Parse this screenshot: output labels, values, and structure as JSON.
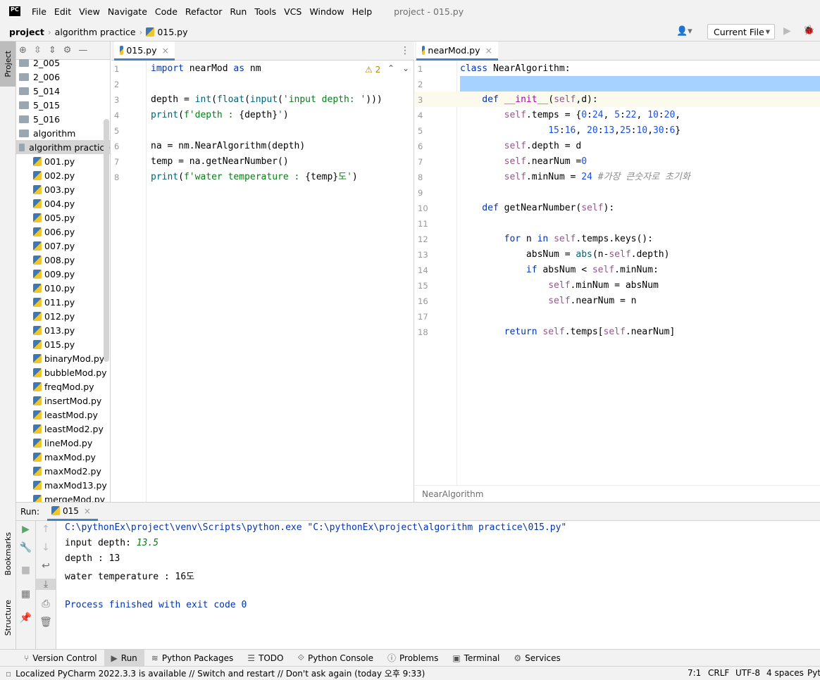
{
  "app": {
    "logo": "PC",
    "window_title": "project - 015.py",
    "menus": [
      "File",
      "Edit",
      "View",
      "Navigate",
      "Code",
      "Refactor",
      "Run",
      "Tools",
      "VCS",
      "Window",
      "Help"
    ]
  },
  "nav": {
    "project": "project",
    "folder": "algorithm practice",
    "file": "015.py",
    "run_config": "Current File"
  },
  "stripe": {
    "project": "Project",
    "bookmarks": "Bookmarks",
    "structure": "Structure"
  },
  "tree": {
    "items": [
      {
        "label": "2_005",
        "type": "folder",
        "indent": 0
      },
      {
        "label": "2_006",
        "type": "folder",
        "indent": 0
      },
      {
        "label": "5_014",
        "type": "folder",
        "indent": 0
      },
      {
        "label": "5_015",
        "type": "folder",
        "indent": 0
      },
      {
        "label": "5_016",
        "type": "folder",
        "indent": 0
      },
      {
        "label": "algorithm",
        "type": "folder",
        "indent": 0
      },
      {
        "label": "algorithm practice",
        "type": "folder",
        "indent": 0,
        "selected": true
      },
      {
        "label": "001.py",
        "type": "py",
        "indent": 1
      },
      {
        "label": "002.py",
        "type": "py",
        "indent": 1
      },
      {
        "label": "003.py",
        "type": "py",
        "indent": 1
      },
      {
        "label": "004.py",
        "type": "py",
        "indent": 1
      },
      {
        "label": "005.py",
        "type": "py",
        "indent": 1
      },
      {
        "label": "006.py",
        "type": "py",
        "indent": 1
      },
      {
        "label": "007.py",
        "type": "py",
        "indent": 1
      },
      {
        "label": "008.py",
        "type": "py",
        "indent": 1
      },
      {
        "label": "009.py",
        "type": "py",
        "indent": 1
      },
      {
        "label": "010.py",
        "type": "py",
        "indent": 1
      },
      {
        "label": "011.py",
        "type": "py",
        "indent": 1
      },
      {
        "label": "012.py",
        "type": "py",
        "indent": 1
      },
      {
        "label": "013.py",
        "type": "py",
        "indent": 1
      },
      {
        "label": "015.py",
        "type": "py",
        "indent": 1
      },
      {
        "label": "binaryMod.py",
        "type": "py",
        "indent": 1
      },
      {
        "label": "bubbleMod.py",
        "type": "py",
        "indent": 1
      },
      {
        "label": "freqMod.py",
        "type": "py",
        "indent": 1
      },
      {
        "label": "insertMod.py",
        "type": "py",
        "indent": 1
      },
      {
        "label": "leastMod.py",
        "type": "py",
        "indent": 1
      },
      {
        "label": "leastMod2.py",
        "type": "py",
        "indent": 1
      },
      {
        "label": "lineMod.py",
        "type": "py",
        "indent": 1
      },
      {
        "label": "maxMod.py",
        "type": "py",
        "indent": 1
      },
      {
        "label": "maxMod2.py",
        "type": "py",
        "indent": 1
      },
      {
        "label": "maxMod13.py",
        "type": "py",
        "indent": 1
      },
      {
        "label": "mergeMod.py",
        "type": "py",
        "indent": 1
      }
    ]
  },
  "editor1": {
    "tab": "015.py",
    "warnings": "2",
    "lines": [
      [
        [
          "import ",
          "kw"
        ],
        [
          "nearMod ",
          ""
        ],
        [
          "as ",
          "kw"
        ],
        [
          "nm",
          ""
        ]
      ],
      [],
      [
        [
          "depth = ",
          ""
        ],
        [
          "int",
          "fn"
        ],
        [
          "(",
          ""
        ],
        [
          "float",
          "fn"
        ],
        [
          "(",
          ""
        ],
        [
          "input",
          "fn"
        ],
        [
          "(",
          ""
        ],
        [
          "'input depth: '",
          "str"
        ],
        [
          ")))",
          ""
        ]
      ],
      [
        [
          "print",
          "fn"
        ],
        [
          "(",
          ""
        ],
        [
          "f'depth : ",
          "str"
        ],
        [
          "{depth}",
          ""
        ],
        [
          "'",
          "str"
        ],
        [
          ")",
          ""
        ]
      ],
      [],
      [
        [
          "na = nm.NearAlgorithm(depth)",
          ""
        ]
      ],
      [
        [
          "temp = na.getNearNumber()",
          ""
        ]
      ],
      [
        [
          "print",
          "fn"
        ],
        [
          "(",
          ""
        ],
        [
          "f'water temperature : ",
          "str"
        ],
        [
          "{temp}",
          ""
        ],
        [
          "도'",
          "str"
        ],
        [
          ")",
          ""
        ]
      ]
    ]
  },
  "editor2": {
    "tab": "nearMod.py",
    "breadcrumb": "NearAlgorithm",
    "lines": [
      [
        [
          "class ",
          "kw"
        ],
        [
          "NearAlgorithm:",
          ""
        ]
      ],
      [],
      [
        [
          "    def ",
          "kw"
        ],
        [
          "__init__",
          "mag"
        ],
        [
          "(",
          ""
        ],
        [
          "self",
          "self"
        ],
        [
          ",d):",
          ""
        ]
      ],
      [
        [
          "        self",
          "self"
        ],
        [
          ".temps = {",
          ""
        ],
        [
          "0",
          "num"
        ],
        [
          ":",
          ""
        ],
        [
          "24",
          "num"
        ],
        [
          ", ",
          ""
        ],
        [
          "5",
          "num"
        ],
        [
          ":",
          ""
        ],
        [
          "22",
          "num"
        ],
        [
          ", ",
          ""
        ],
        [
          "10",
          "num"
        ],
        [
          ":",
          ""
        ],
        [
          "20",
          "num"
        ],
        [
          ",",
          ""
        ]
      ],
      [
        [
          "                ",
          ""
        ],
        [
          "15",
          "num"
        ],
        [
          ":",
          ""
        ],
        [
          "16",
          "num"
        ],
        [
          ", ",
          ""
        ],
        [
          "20",
          "num"
        ],
        [
          ":",
          ""
        ],
        [
          "13",
          "num"
        ],
        [
          ",",
          ""
        ],
        [
          "25",
          "num"
        ],
        [
          ":",
          ""
        ],
        [
          "10",
          "num"
        ],
        [
          ",",
          ""
        ],
        [
          "30",
          "num"
        ],
        [
          ":",
          ""
        ],
        [
          "6",
          "num"
        ],
        [
          "}",
          ""
        ]
      ],
      [
        [
          "        self",
          "self"
        ],
        [
          ".depth = d",
          ""
        ]
      ],
      [
        [
          "        self",
          "self"
        ],
        [
          ".nearNum =",
          ""
        ],
        [
          "0",
          "num"
        ]
      ],
      [
        [
          "        self",
          "self"
        ],
        [
          ".minNum = ",
          ""
        ],
        [
          "24 ",
          "num"
        ],
        [
          "#가장 큰숫자로 초기화",
          "cm"
        ]
      ],
      [],
      [
        [
          "    def ",
          "kw"
        ],
        [
          "getNearNumber",
          ""
        ],
        [
          "(",
          ""
        ],
        [
          "self",
          "self"
        ],
        [
          "):",
          ""
        ]
      ],
      [],
      [
        [
          "        for ",
          "kw"
        ],
        [
          "n ",
          ""
        ],
        [
          "in ",
          "kw"
        ],
        [
          "self",
          "self"
        ],
        [
          ".temps.keys():",
          ""
        ]
      ],
      [
        [
          "            absNum = ",
          ""
        ],
        [
          "abs",
          "fn"
        ],
        [
          "(n-",
          ""
        ],
        [
          "self",
          "self"
        ],
        [
          ".depth)",
          ""
        ]
      ],
      [
        [
          "            if ",
          "kw"
        ],
        [
          "absNum < ",
          ""
        ],
        [
          "self",
          "self"
        ],
        [
          ".minNum:",
          ""
        ]
      ],
      [
        [
          "                self",
          "self"
        ],
        [
          ".minNum = absNum",
          ""
        ]
      ],
      [
        [
          "                self",
          "self"
        ],
        [
          ".nearNum = n",
          ""
        ]
      ],
      [],
      [
        [
          "        return ",
          "kw"
        ],
        [
          "self",
          "self"
        ],
        [
          ".temps[",
          ""
        ],
        [
          "self",
          "self"
        ],
        [
          ".nearNum]",
          ""
        ]
      ]
    ]
  },
  "run": {
    "label": "Run:",
    "tab": "015",
    "output": [
      {
        "text": "C:\\pythonEx\\project\\venv\\Scripts\\python.exe \"C:\\pythonEx\\project\\algorithm practice\\015.py\"",
        "style": "cmd"
      },
      {
        "text": "input depth: ",
        "style": "plain",
        "input": "13.5"
      },
      {
        "text": "depth : 13",
        "style": "plain"
      },
      {
        "text": "water temperature : 16도",
        "style": "plain"
      },
      {
        "text": "",
        "style": "plain"
      },
      {
        "text": "Process finished with exit code 0",
        "style": "cmd"
      }
    ]
  },
  "bottom_tabs": [
    "Version Control",
    "Run",
    "Python Packages",
    "TODO",
    "Python Console",
    "Problems",
    "Terminal",
    "Services"
  ],
  "status": {
    "message": "Localized PyCharm 2022.3.3 is available // Switch and restart // Don't ask again (today 오후 9:33)",
    "position": "7:1",
    "line_sep": "CRLF",
    "encoding": "UTF-8",
    "indent": "4 spaces",
    "interpreter": "Pyt"
  },
  "colors": {
    "accent": "#4083c9",
    "selection": "#a6d2ff",
    "keyword": "#0033b3",
    "string": "#067d17",
    "number": "#1750eb",
    "self": "#94558d"
  }
}
